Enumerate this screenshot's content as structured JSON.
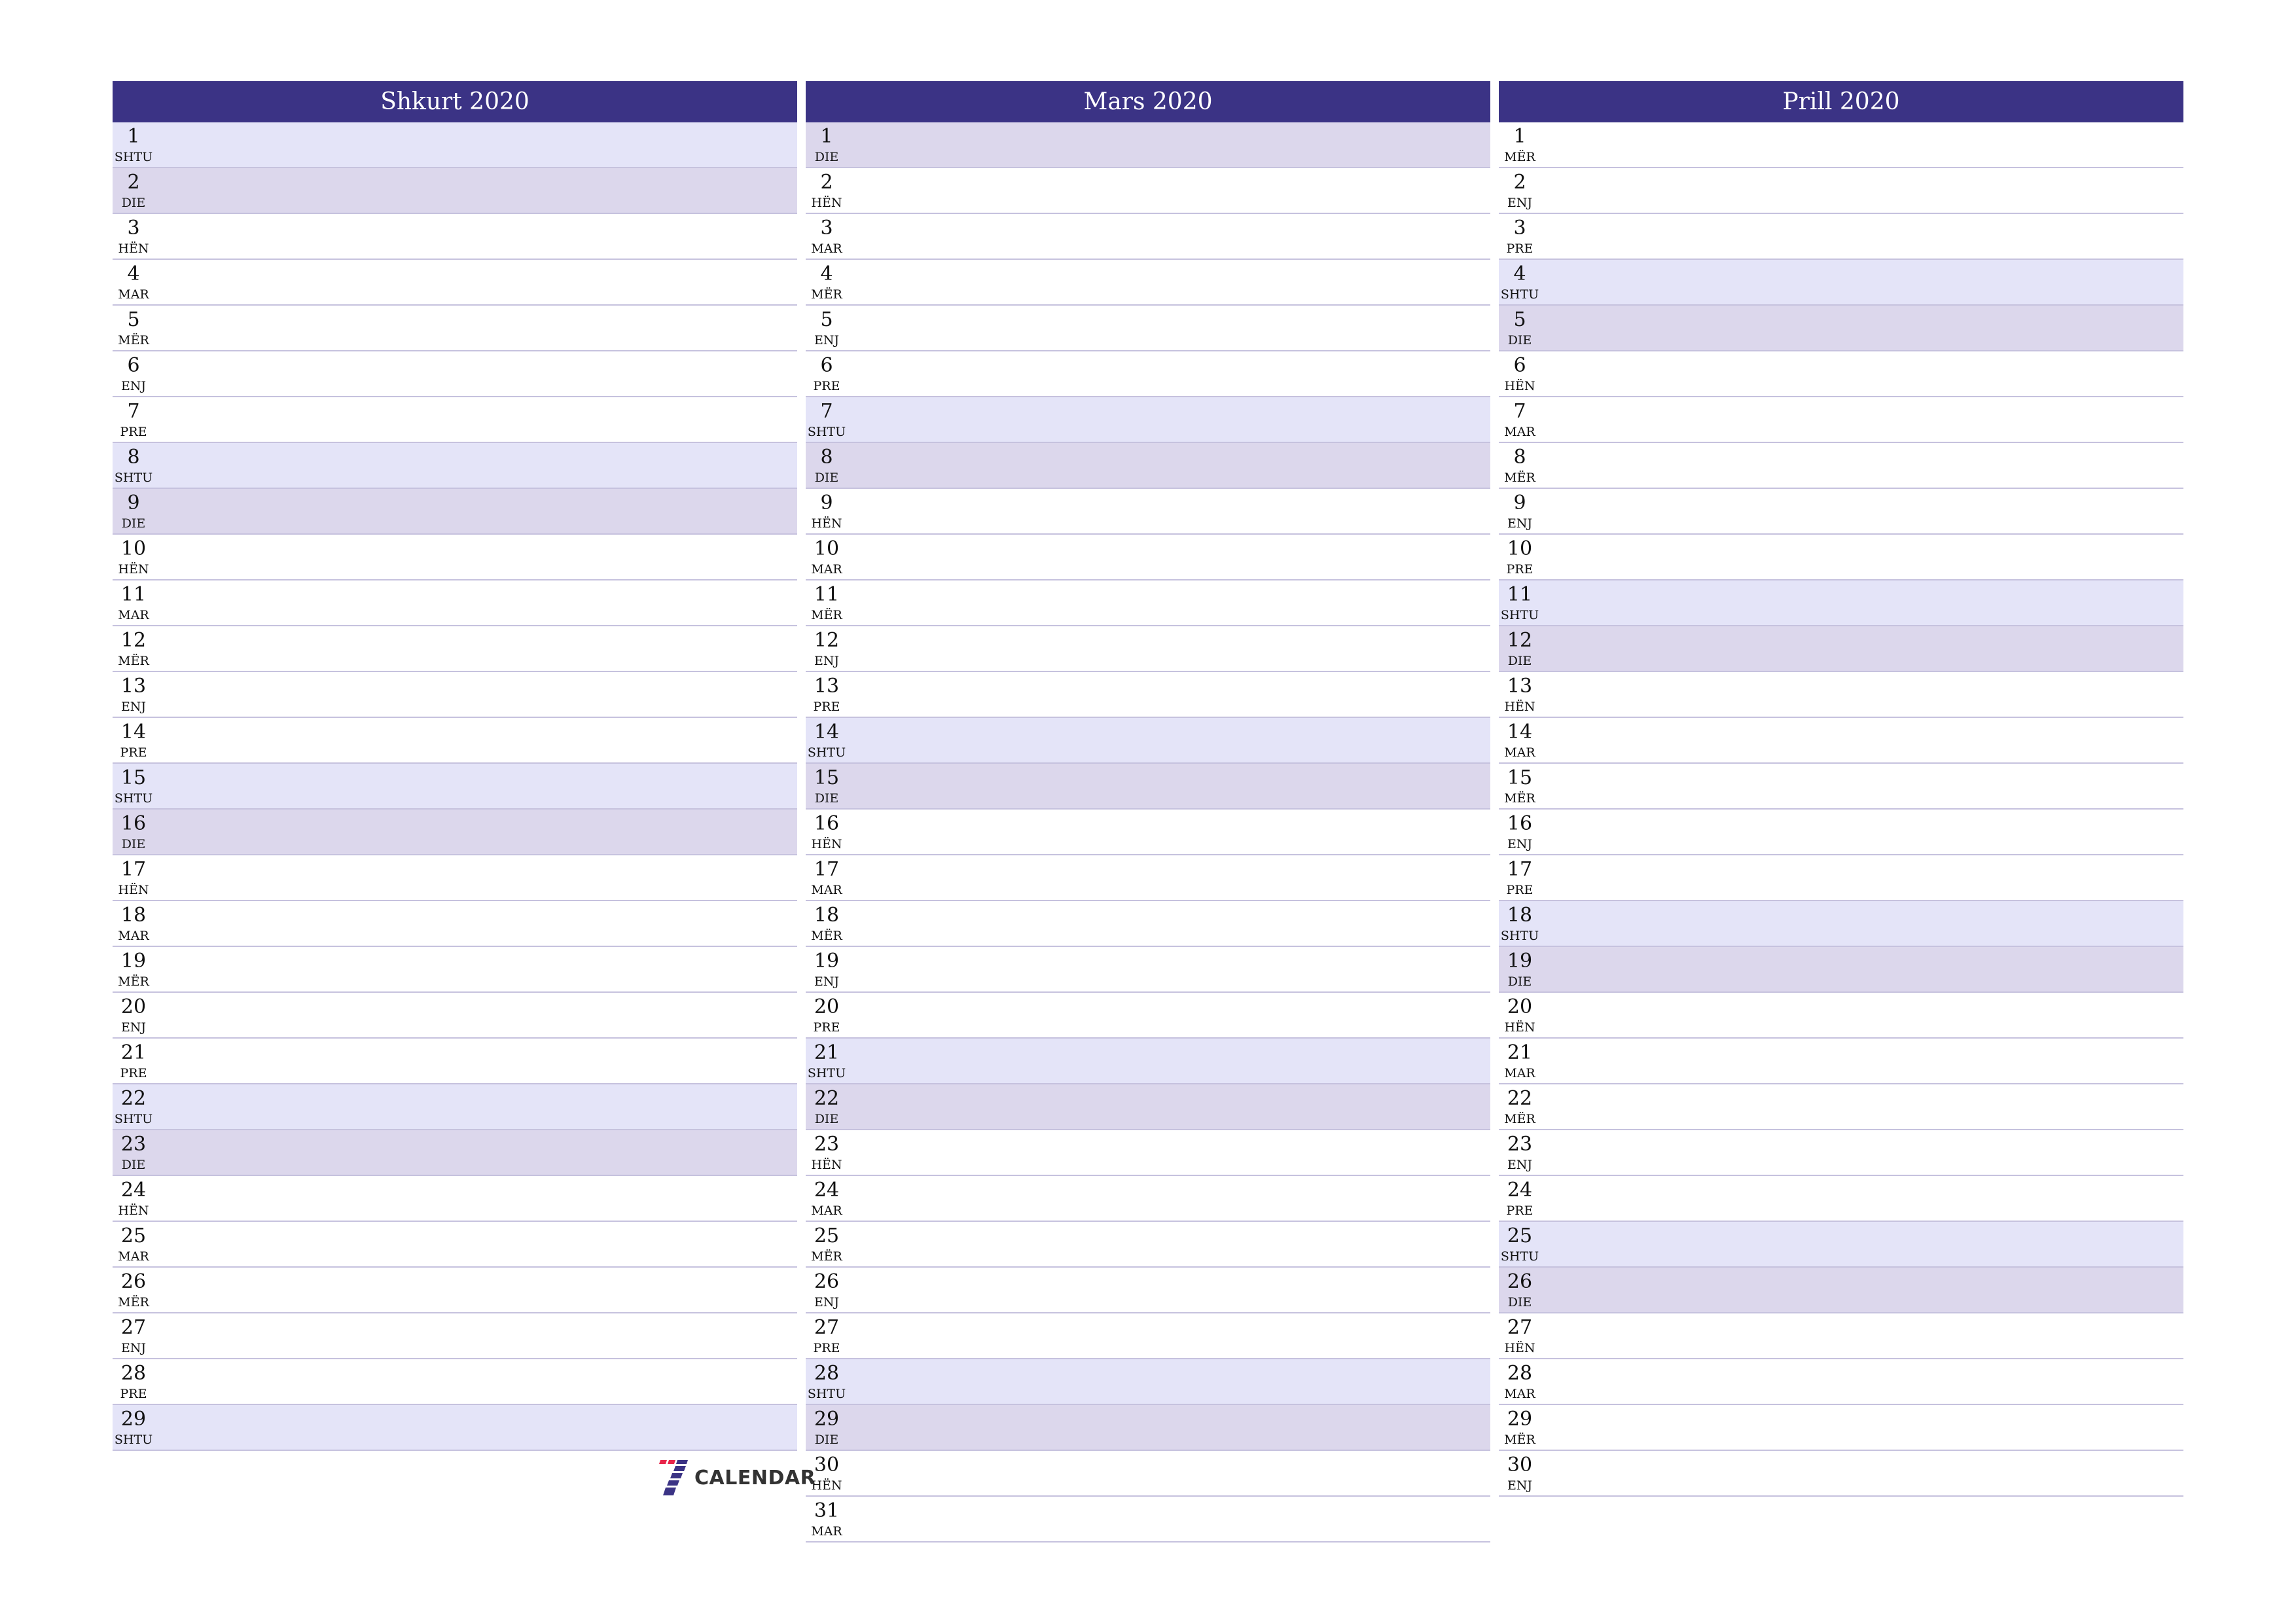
{
  "colors": {
    "header": "#3b3385",
    "saturday": "#e4e4f8",
    "sunday": "#dcd7ec",
    "separator": "#c6c2de"
  },
  "months": [
    {
      "title": "Shkurt 2020",
      "days": [
        {
          "n": "1",
          "d": "SHTU"
        },
        {
          "n": "2",
          "d": "DIE"
        },
        {
          "n": "3",
          "d": "HËN"
        },
        {
          "n": "4",
          "d": "MAR"
        },
        {
          "n": "5",
          "d": "MËR"
        },
        {
          "n": "6",
          "d": "ENJ"
        },
        {
          "n": "7",
          "d": "PRE"
        },
        {
          "n": "8",
          "d": "SHTU"
        },
        {
          "n": "9",
          "d": "DIE"
        },
        {
          "n": "10",
          "d": "HËN"
        },
        {
          "n": "11",
          "d": "MAR"
        },
        {
          "n": "12",
          "d": "MËR"
        },
        {
          "n": "13",
          "d": "ENJ"
        },
        {
          "n": "14",
          "d": "PRE"
        },
        {
          "n": "15",
          "d": "SHTU"
        },
        {
          "n": "16",
          "d": "DIE"
        },
        {
          "n": "17",
          "d": "HËN"
        },
        {
          "n": "18",
          "d": "MAR"
        },
        {
          "n": "19",
          "d": "MËR"
        },
        {
          "n": "20",
          "d": "ENJ"
        },
        {
          "n": "21",
          "d": "PRE"
        },
        {
          "n": "22",
          "d": "SHTU"
        },
        {
          "n": "23",
          "d": "DIE"
        },
        {
          "n": "24",
          "d": "HËN"
        },
        {
          "n": "25",
          "d": "MAR"
        },
        {
          "n": "26",
          "d": "MËR"
        },
        {
          "n": "27",
          "d": "ENJ"
        },
        {
          "n": "28",
          "d": "PRE"
        },
        {
          "n": "29",
          "d": "SHTU"
        }
      ]
    },
    {
      "title": "Mars 2020",
      "days": [
        {
          "n": "1",
          "d": "DIE"
        },
        {
          "n": "2",
          "d": "HËN"
        },
        {
          "n": "3",
          "d": "MAR"
        },
        {
          "n": "4",
          "d": "MËR"
        },
        {
          "n": "5",
          "d": "ENJ"
        },
        {
          "n": "6",
          "d": "PRE"
        },
        {
          "n": "7",
          "d": "SHTU"
        },
        {
          "n": "8",
          "d": "DIE"
        },
        {
          "n": "9",
          "d": "HËN"
        },
        {
          "n": "10",
          "d": "MAR"
        },
        {
          "n": "11",
          "d": "MËR"
        },
        {
          "n": "12",
          "d": "ENJ"
        },
        {
          "n": "13",
          "d": "PRE"
        },
        {
          "n": "14",
          "d": "SHTU"
        },
        {
          "n": "15",
          "d": "DIE"
        },
        {
          "n": "16",
          "d": "HËN"
        },
        {
          "n": "17",
          "d": "MAR"
        },
        {
          "n": "18",
          "d": "MËR"
        },
        {
          "n": "19",
          "d": "ENJ"
        },
        {
          "n": "20",
          "d": "PRE"
        },
        {
          "n": "21",
          "d": "SHTU"
        },
        {
          "n": "22",
          "d": "DIE"
        },
        {
          "n": "23",
          "d": "HËN"
        },
        {
          "n": "24",
          "d": "MAR"
        },
        {
          "n": "25",
          "d": "MËR"
        },
        {
          "n": "26",
          "d": "ENJ"
        },
        {
          "n": "27",
          "d": "PRE"
        },
        {
          "n": "28",
          "d": "SHTU"
        },
        {
          "n": "29",
          "d": "DIE"
        },
        {
          "n": "30",
          "d": "HËN"
        },
        {
          "n": "31",
          "d": "MAR"
        }
      ]
    },
    {
      "title": "Prill 2020",
      "days": [
        {
          "n": "1",
          "d": "MËR"
        },
        {
          "n": "2",
          "d": "ENJ"
        },
        {
          "n": "3",
          "d": "PRE"
        },
        {
          "n": "4",
          "d": "SHTU"
        },
        {
          "n": "5",
          "d": "DIE"
        },
        {
          "n": "6",
          "d": "HËN"
        },
        {
          "n": "7",
          "d": "MAR"
        },
        {
          "n": "8",
          "d": "MËR"
        },
        {
          "n": "9",
          "d": "ENJ"
        },
        {
          "n": "10",
          "d": "PRE"
        },
        {
          "n": "11",
          "d": "SHTU"
        },
        {
          "n": "12",
          "d": "DIE"
        },
        {
          "n": "13",
          "d": "HËN"
        },
        {
          "n": "14",
          "d": "MAR"
        },
        {
          "n": "15",
          "d": "MËR"
        },
        {
          "n": "16",
          "d": "ENJ"
        },
        {
          "n": "17",
          "d": "PRE"
        },
        {
          "n": "18",
          "d": "SHTU"
        },
        {
          "n": "19",
          "d": "DIE"
        },
        {
          "n": "20",
          "d": "HËN"
        },
        {
          "n": "21",
          "d": "MAR"
        },
        {
          "n": "22",
          "d": "MËR"
        },
        {
          "n": "23",
          "d": "ENJ"
        },
        {
          "n": "24",
          "d": "PRE"
        },
        {
          "n": "25",
          "d": "SHTU"
        },
        {
          "n": "26",
          "d": "DIE"
        },
        {
          "n": "27",
          "d": "HËN"
        },
        {
          "n": "28",
          "d": "MAR"
        },
        {
          "n": "29",
          "d": "MËR"
        },
        {
          "n": "30",
          "d": "ENJ"
        }
      ]
    }
  ],
  "logo": {
    "icon": "seven-calendar-logo-icon",
    "text": "CALENDAR"
  }
}
